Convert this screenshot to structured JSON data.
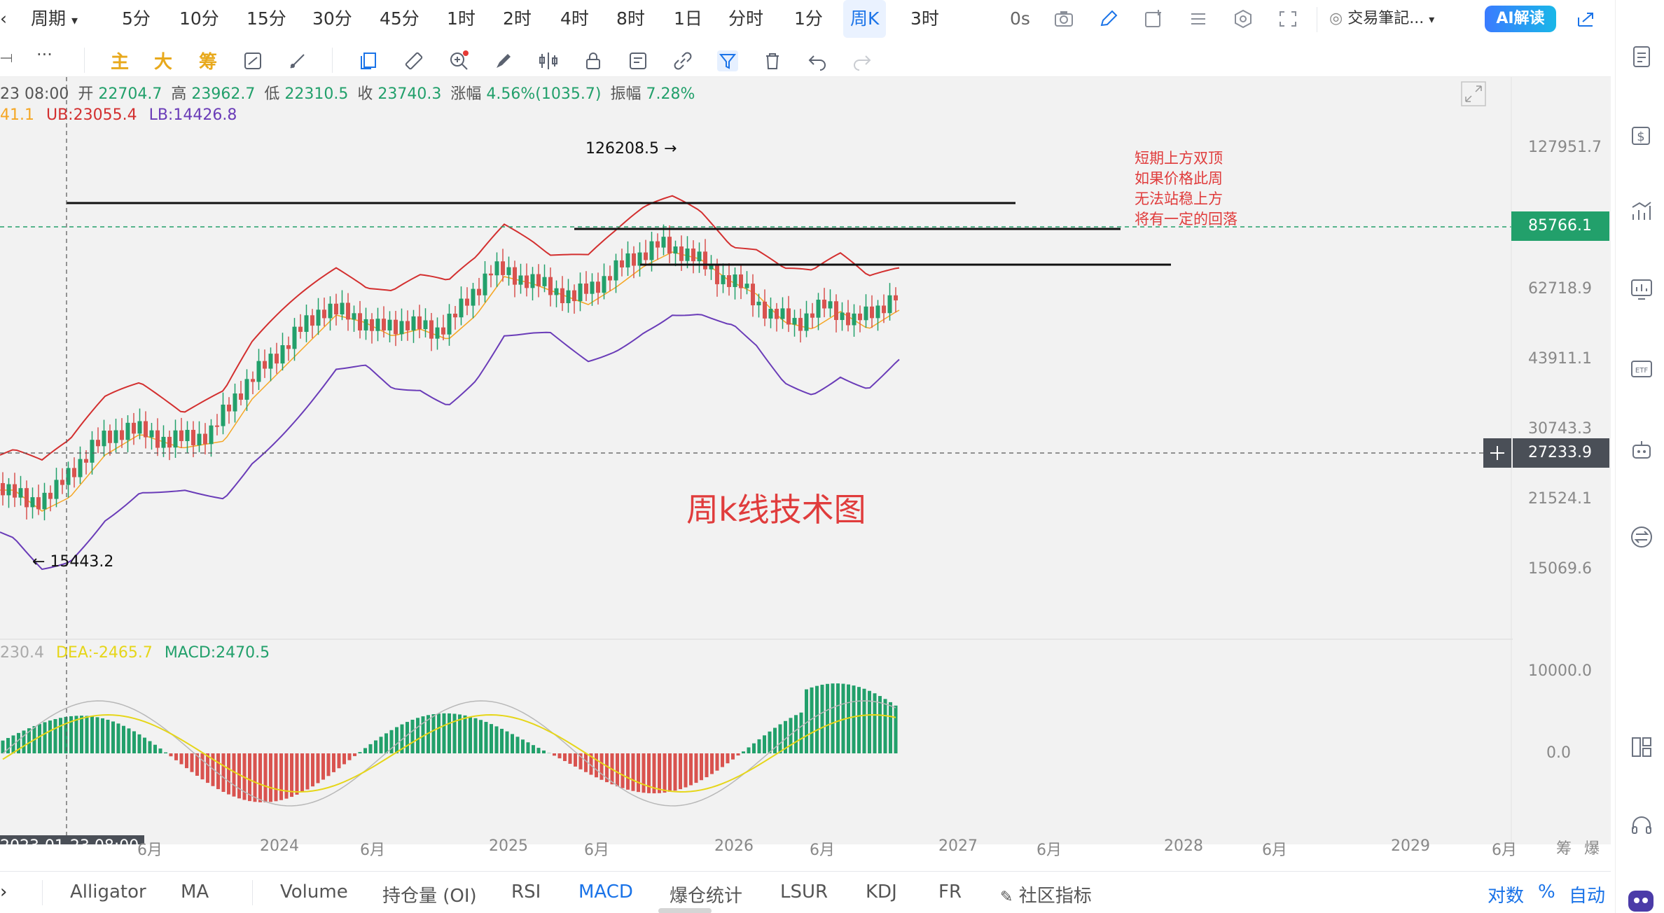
{
  "toolbar": {
    "period_label": "周期",
    "intervals": [
      "5分",
      "10分",
      "15分",
      "30分",
      "45分",
      "1时",
      "2时",
      "4时",
      "8时",
      "1日",
      "分时",
      "1分",
      "周K",
      "3时"
    ],
    "active_interval": "周K",
    "countdown": "0s",
    "trade_note_label": "交易筆記...",
    "ai_button": "AI解读"
  },
  "drawbar": {
    "main_label": "主",
    "big_label": "大",
    "chip_label": "筹"
  },
  "ohlc": {
    "date_prefix": "23 08:00",
    "open_label": "开",
    "open": "22704.7",
    "high_label": "高",
    "high": "23962.7",
    "low_label": "低",
    "low": "22310.5",
    "close_label": "收",
    "close": "23740.3",
    "change_label": "涨幅",
    "change": "4.56%(1035.7)",
    "amplitude_label": "振幅",
    "amplitude": "7.28%"
  },
  "boll": {
    "mid": "41.1",
    "ub": "UB:23055.4",
    "lb": "LB:14426.8"
  },
  "price_axis": {
    "ticks": [
      "127951.7",
      "62718.9",
      "43911.1",
      "30743.3",
      "21524.1",
      "15069.6"
    ],
    "current_price": "85766.1",
    "cursor_price": "27233.9"
  },
  "annotations": {
    "high_marker": "126208.5",
    "low_marker": "15443.2",
    "note_lines": [
      "短期上方双顶",
      "如果价格此周",
      "无法站稳上方",
      "将有一定的回落"
    ],
    "chart_title": "周k线技术图"
  },
  "macd": {
    "dif": "230.4",
    "dea": "DEA:-2465.7",
    "macd": "MACD:2470.5",
    "axis_top": "10000.0",
    "axis_zero": "0.0"
  },
  "time_axis": {
    "cursor_time": "2023-01-23 08:00",
    "labels": [
      "6月",
      "2024",
      "6月",
      "2025",
      "6月",
      "2026",
      "6月",
      "2027",
      "6月",
      "2028",
      "6月",
      "2029",
      "6月"
    ],
    "right_labels": [
      "筹",
      "爆"
    ]
  },
  "indicators": {
    "tabs": [
      "Alligator",
      "MA",
      "Volume",
      "持仓量 (OI)",
      "RSI",
      "MACD",
      "爆仓统计",
      "LSUR",
      "KDJ",
      "FR",
      "社区指标"
    ],
    "active": "MACD",
    "scale_options": [
      "对数",
      "%",
      "自动"
    ]
  },
  "colors": {
    "up": "#22a06b",
    "down": "#d9534f",
    "ub_line": "#d32f2f",
    "lb_line": "#6a3cb8",
    "mid_line": "#f5a623",
    "dea_line": "#e6d619",
    "dif_line": "#b8b8b8",
    "annotation": "#e03c3c",
    "accent": "#1a73e8"
  }
}
